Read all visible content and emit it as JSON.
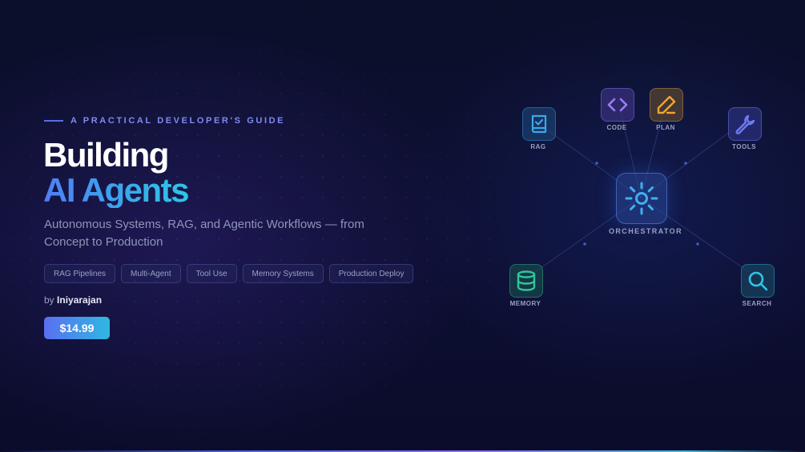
{
  "eyebrow": "A PRACTICAL DEVELOPER'S GUIDE",
  "title": {
    "line1": "Building",
    "line2": "AI Agents"
  },
  "subtitle": "Autonomous Systems, RAG, and Agentic Workflows — from Concept to Production",
  "tags": [
    "RAG Pipelines",
    "Multi-Agent",
    "Tool Use",
    "Memory Systems",
    "Production Deploy"
  ],
  "byline": {
    "prefix": "by",
    "author": "Iniyarajan"
  },
  "price": "$14.99",
  "diagram": {
    "center": {
      "label": "ORCHESTRATOR",
      "icon": "sun-icon"
    },
    "nodes": [
      {
        "label": "RAG",
        "icon": "book-check-icon",
        "color": "#3aa8ea"
      },
      {
        "label": "CODE",
        "icon": "code-brackets-icon",
        "color": "#9b7cf5"
      },
      {
        "label": "PLAN",
        "icon": "pencil-icon",
        "color": "#f2a52b"
      },
      {
        "label": "TOOLS",
        "icon": "wrench-icon",
        "color": "#6d7cf2"
      },
      {
        "label": "MEMORY",
        "icon": "database-icon",
        "color": "#2fc79a"
      },
      {
        "label": "SEARCH",
        "icon": "search-icon",
        "color": "#2dc6e6"
      }
    ]
  },
  "colors": {
    "accent": "#5a6ef2",
    "cyan": "#2dc6e6",
    "background": "#0c0f30"
  }
}
